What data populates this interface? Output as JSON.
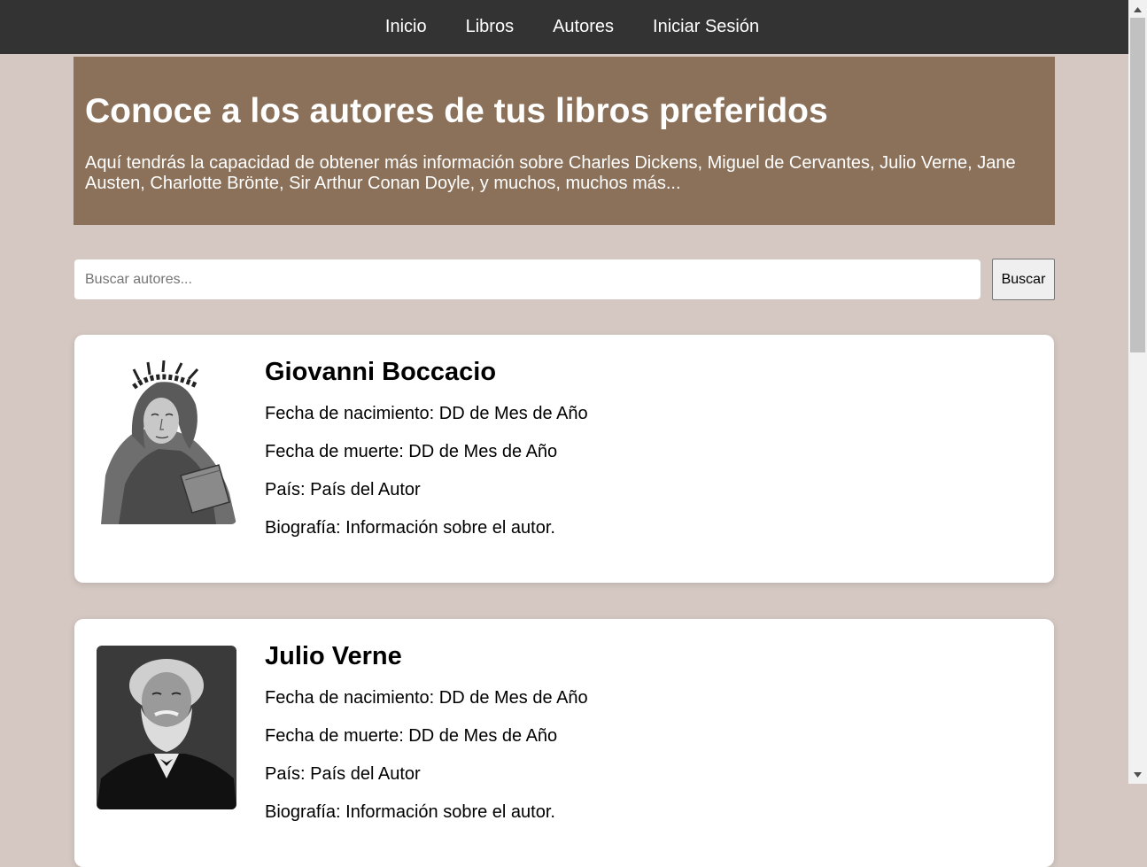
{
  "nav": {
    "links": [
      "Inicio",
      "Libros",
      "Autores",
      "Iniciar Sesión"
    ]
  },
  "hero": {
    "title": "Conoce a los autores de tus libros preferidos",
    "text": "Aquí tendrás la capacidad de obtener más información sobre Charles Dickens, Miguel de Cervantes, Julio Verne, Jane Austen, Charlotte Brönte, Sir Arthur Conan Doyle, y muchos, muchos más..."
  },
  "search": {
    "placeholder": "Buscar autores...",
    "value": "",
    "button_label": "Buscar"
  },
  "authors": [
    {
      "name": "Giovanni Boccacio",
      "birth": "Fecha de nacimiento: DD de Mes de Año",
      "death": "Fecha de muerte: DD de Mes de Año",
      "country": "País: País del Autor",
      "bio": "Biografía: Información sobre el autor."
    },
    {
      "name": "Julio Verne",
      "birth": "Fecha de nacimiento: DD de Mes de Año",
      "death": "Fecha de muerte: DD de Mes de Año",
      "country": "País: País del Autor",
      "bio": "Biografía: Información sobre el autor."
    }
  ],
  "colors": {
    "navbar": "#333333",
    "hero": "#8b7159",
    "page_background": "#d5c8c3"
  }
}
